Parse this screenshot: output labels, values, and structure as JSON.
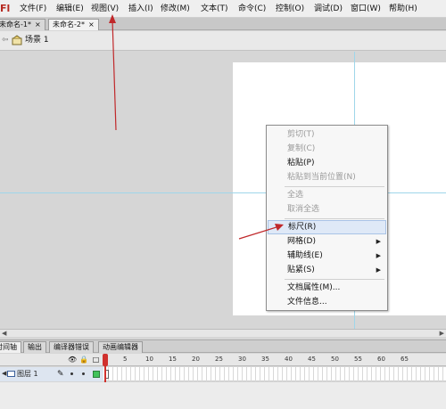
{
  "app": {
    "logo": "Fl"
  },
  "menubar": {
    "items": [
      "文件(F)",
      "编辑(E)",
      "视图(V)",
      "插入(I)",
      "修改(M)",
      "文本(T)",
      "命令(C)",
      "控制(O)",
      "调试(D)",
      "窗口(W)",
      "帮助(H)"
    ]
  },
  "document_tabs": [
    {
      "label": "未命名-1*",
      "close": "×"
    },
    {
      "label": "未命名-2*",
      "close": "×"
    }
  ],
  "scene": {
    "label": "场景 1"
  },
  "context_menu": {
    "items": [
      {
        "label": "剪切(T)",
        "disabled": true
      },
      {
        "label": "复制(C)",
        "disabled": true
      },
      {
        "label": "粘贴(P)",
        "disabled": false
      },
      {
        "label": "粘贴到当前位置(N)",
        "disabled": true
      },
      {
        "label": "全选",
        "disabled": true
      },
      {
        "label": "取消全选",
        "disabled": true
      },
      {
        "label": "标尺(R)",
        "disabled": false,
        "highlighted": true
      },
      {
        "label": "网格(D)",
        "disabled": false,
        "submenu": true
      },
      {
        "label": "辅助线(E)",
        "disabled": false,
        "submenu": true
      },
      {
        "label": "贴紧(S)",
        "disabled": false,
        "submenu": true
      },
      {
        "label": "文档属性(M)...",
        "disabled": false
      },
      {
        "label": "文件信息...",
        "disabled": false
      }
    ],
    "submenu_arrow": "▶"
  },
  "timeline": {
    "tabs": [
      "时间轴",
      "输出",
      "编译器错误",
      "动画编辑器"
    ],
    "header_icons": {
      "eye": "👁",
      "lock": "🔒",
      "outline": "□"
    },
    "frame_numbers": [
      "1",
      "5",
      "10",
      "15",
      "20",
      "25",
      "30",
      "35",
      "40",
      "45",
      "50",
      "55",
      "60",
      "65"
    ],
    "layer": {
      "name": "图层 1",
      "pencil": "✎"
    }
  },
  "colors": {
    "annotation_arrow": "#c0282a",
    "guide_line": "#9fd6ea",
    "playhead": "#d0312d",
    "outline_box": "#41c35a"
  }
}
